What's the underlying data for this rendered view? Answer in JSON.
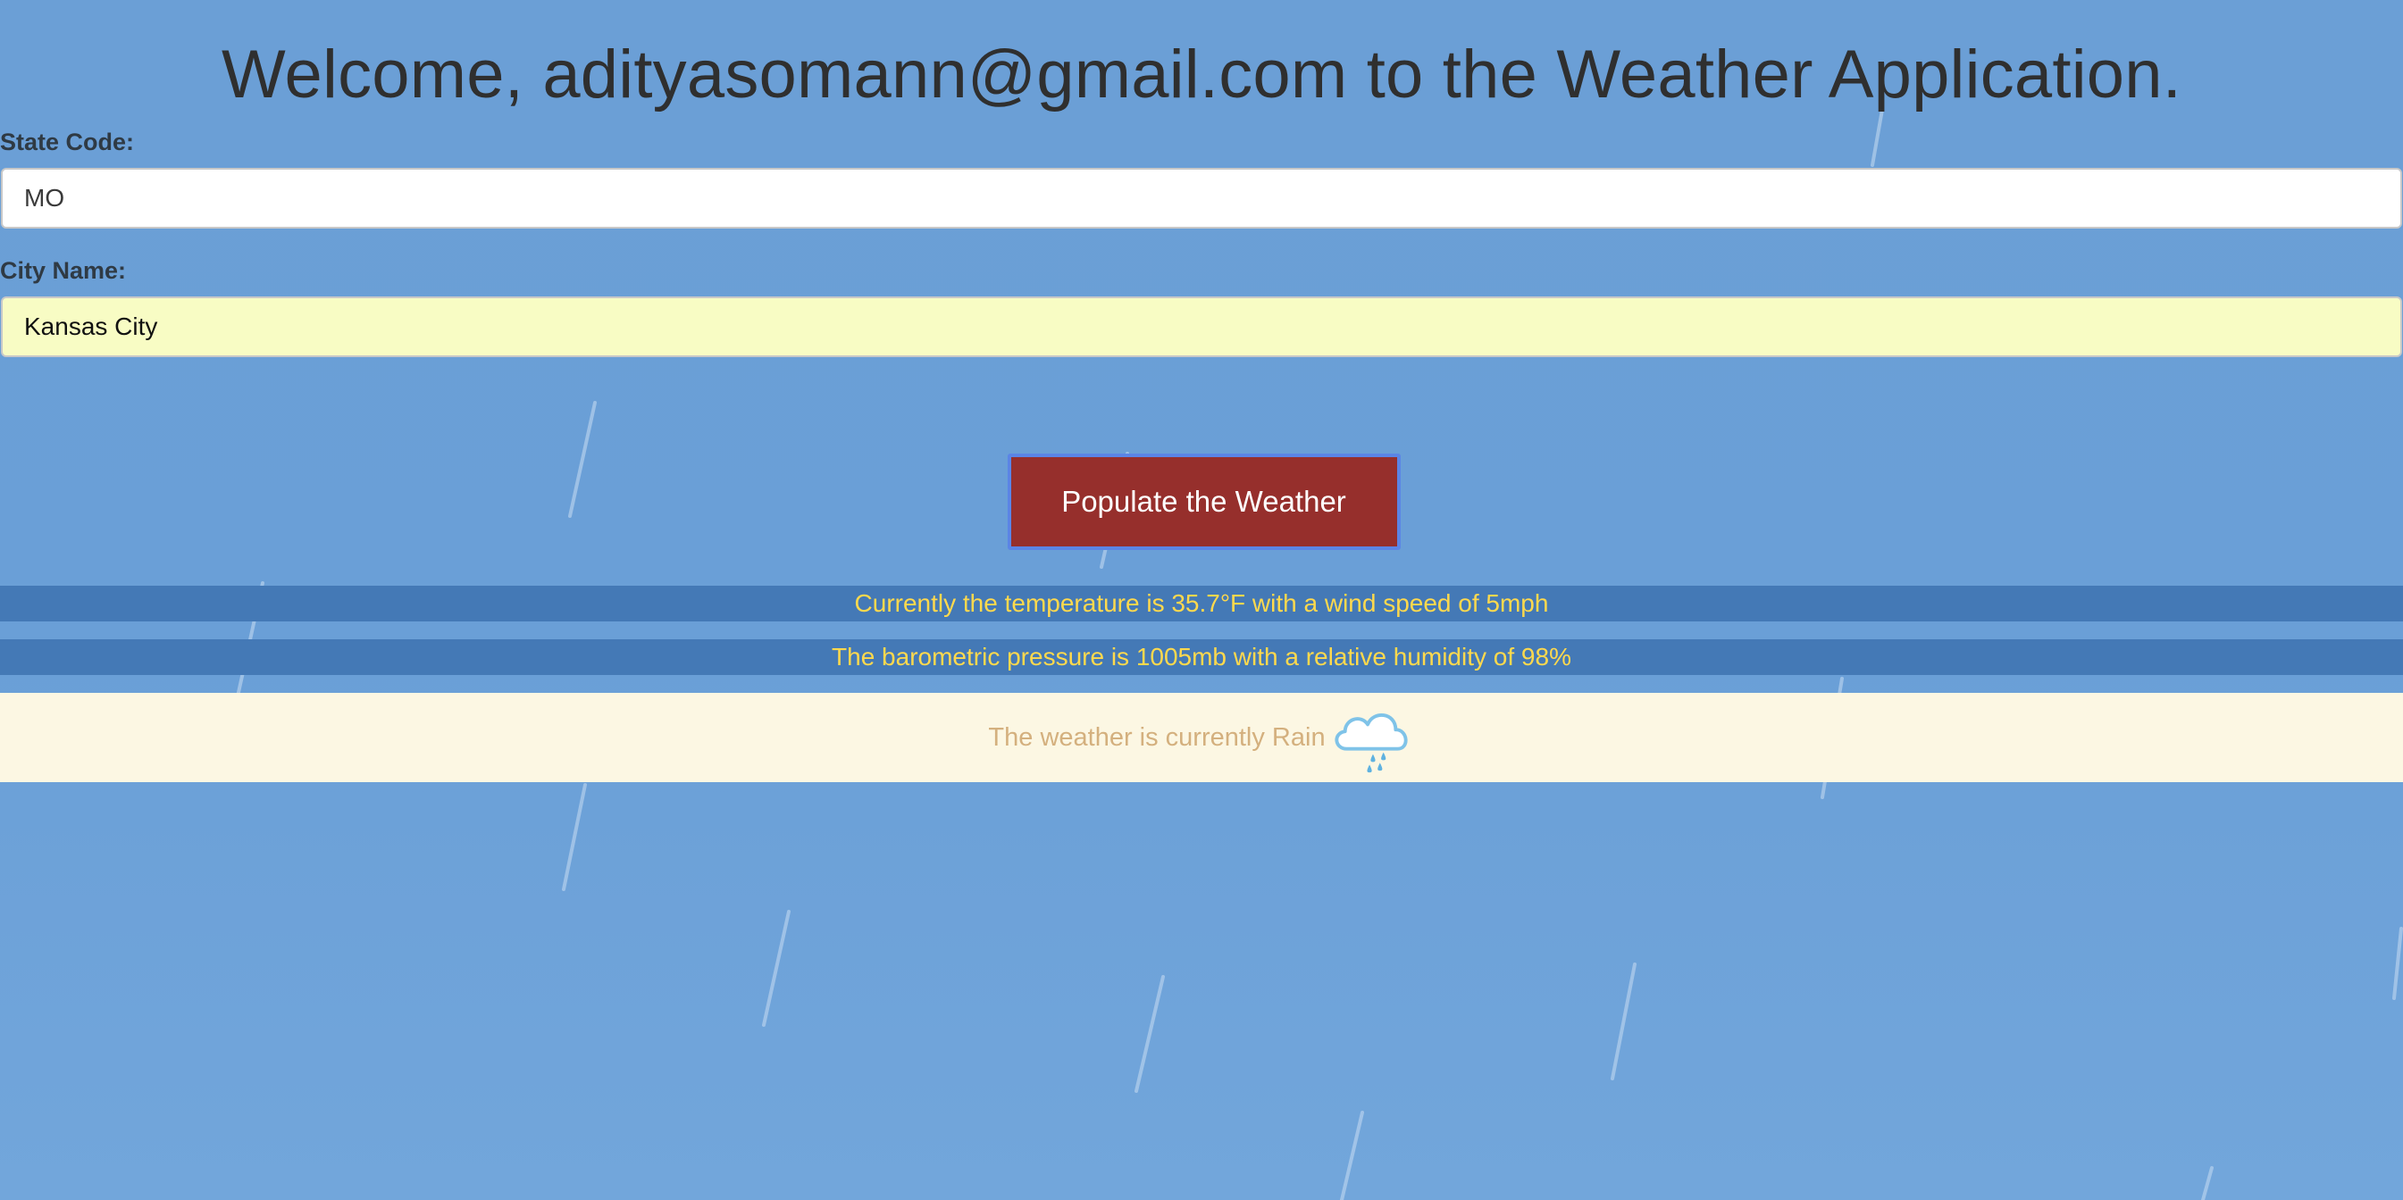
{
  "header": {
    "title": "Welcome, adityasomann@gmail.com to the Weather Application."
  },
  "form": {
    "state_label": "State Code:",
    "state_value": "MO",
    "city_label": "City Name:",
    "city_value": "Kansas City",
    "submit_label": "Populate the Weather"
  },
  "results": {
    "temperature_line": "Currently the temperature is 35.7°F with a wind speed of 5mph",
    "pressure_line": "The barometric pressure is 1005mb with a relative humidity of 98%",
    "condition_line": "The weather is currently Rain",
    "condition_icon": "rain-cloud-icon"
  },
  "colors": {
    "background": "#6a9fd7",
    "title_text": "#2f2f2f",
    "button_bg": "#962f2c",
    "button_border": "#5b85e6",
    "info_bar_bg": "#4479b6",
    "info_bar_text": "#ffd94d",
    "condition_bg": "#fcf7e3",
    "condition_text": "#d4b07e"
  }
}
